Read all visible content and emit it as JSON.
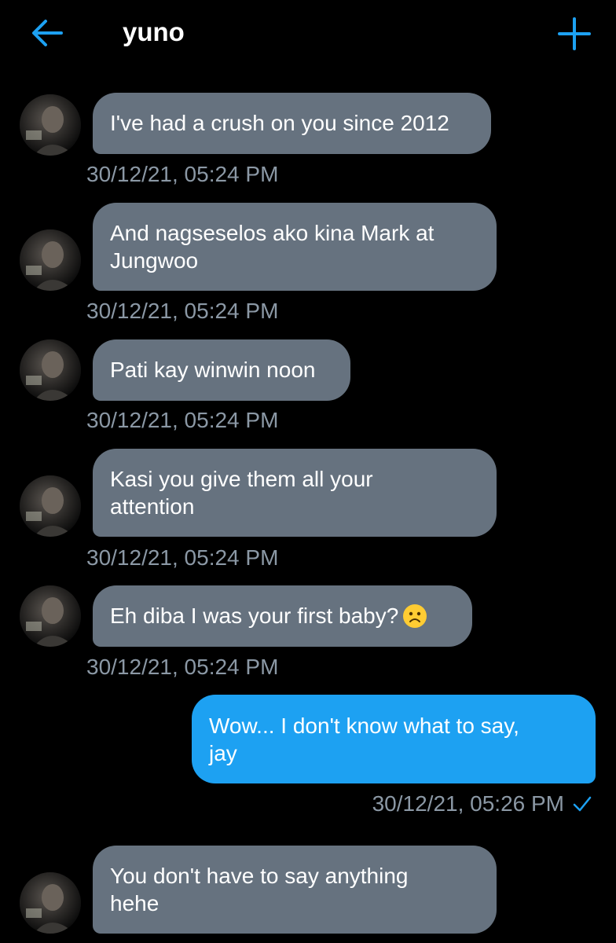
{
  "header": {
    "title": "yuno",
    "back_icon": "arrow-left-icon",
    "add_icon": "plus-icon",
    "accent": "#1da1f2"
  },
  "messages": [
    {
      "direction": "incoming",
      "text": "I've had a crush on you since 2012",
      "time": "30/12/21, 05:24 PM"
    },
    {
      "direction": "incoming",
      "text_lines": [
        "And nagseselos ako kina Mark at",
        "Jungwoo"
      ],
      "time": "30/12/21, 05:24 PM"
    },
    {
      "direction": "incoming",
      "text": "Pati kay winwin noon",
      "time": "30/12/21, 05:24 PM"
    },
    {
      "direction": "incoming",
      "text_lines": [
        "Kasi you give them all your",
        "attention"
      ],
      "time": "30/12/21, 05:24 PM"
    },
    {
      "direction": "incoming",
      "text": "Eh diba I was your first baby?",
      "emoji": "frowning-face-icon",
      "time": "30/12/21, 05:24 PM"
    },
    {
      "direction": "outgoing",
      "text_lines": [
        "Wow... I don't know what to say,",
        "jay"
      ],
      "time": "30/12/21, 05:26 PM",
      "status_icon": "check-icon"
    },
    {
      "direction": "incoming",
      "text_lines": [
        "You don't have to say anything",
        "hehe"
      ]
    }
  ],
  "colors": {
    "incoming_bubble": "#66727f",
    "outgoing_bubble": "#1da1f2",
    "timestamp": "#8b98a5",
    "background": "#000000"
  }
}
